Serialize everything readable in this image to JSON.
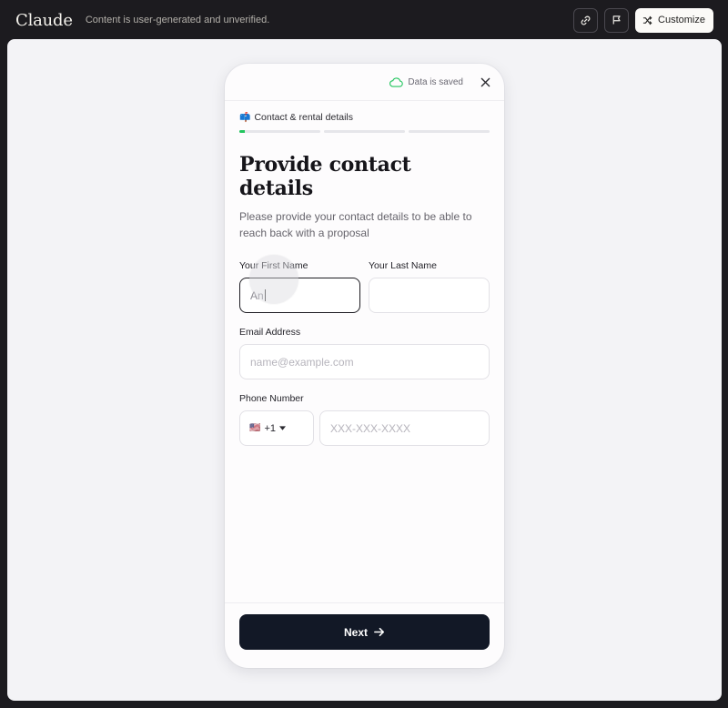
{
  "app": {
    "brand": "Claude",
    "notice": "Content is user-generated and unverified.",
    "customize_label": "Customize",
    "icons": [
      "link-icon",
      "flag-icon",
      "shuffle-icon"
    ]
  },
  "form": {
    "saved_status": "Data is saved",
    "step_label": "Contact & rental details",
    "step_emoji": "📫",
    "progress": [
      0.07,
      0,
      0
    ],
    "title": "Provide contact details",
    "subtitle": "Please provide your contact details to be able to reach back with a proposal",
    "first_name": {
      "label": "Your First Name",
      "value": "An"
    },
    "last_name": {
      "label": "Your Last Name",
      "value": ""
    },
    "email": {
      "label": "Email Address",
      "placeholder": "name@example.com"
    },
    "phone": {
      "label": "Phone Number",
      "country_flag": "🇺🇸",
      "country_code": "+1",
      "placeholder": "XXX-XXX-XXXX"
    },
    "next_label": "Next",
    "accent_color": "#22c55e",
    "button_color": "#121826"
  }
}
